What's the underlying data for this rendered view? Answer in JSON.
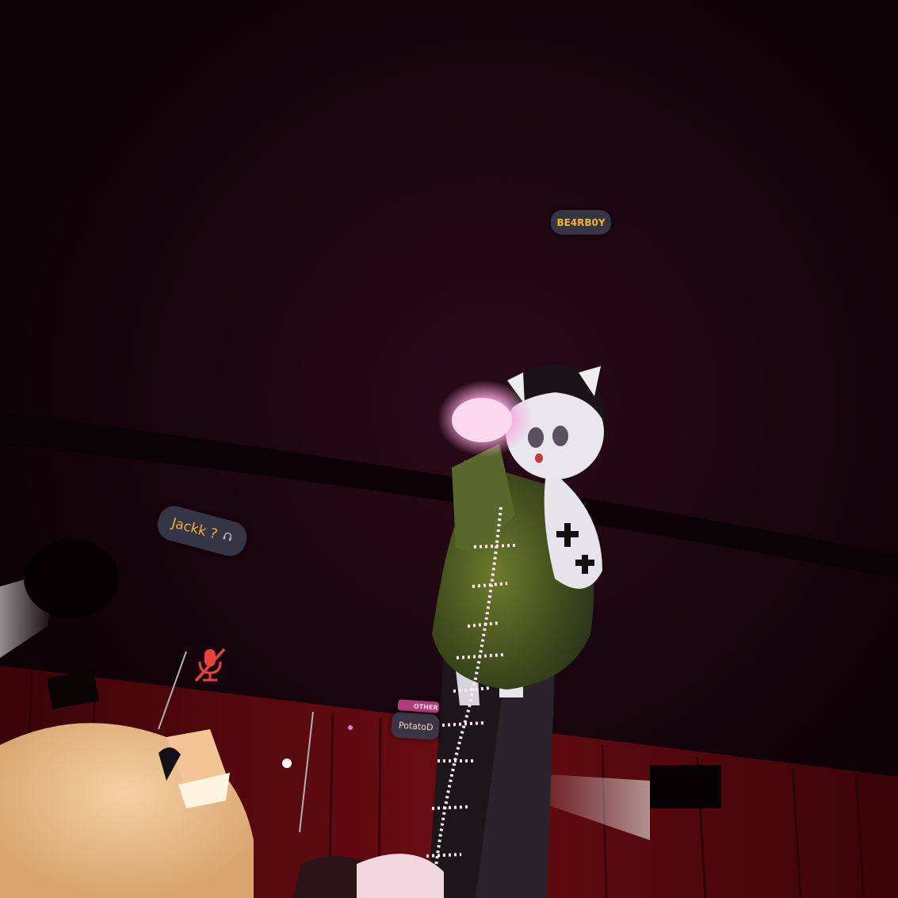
{
  "nameplates": {
    "bear": {
      "name": "BE4RB0Y"
    },
    "jack": {
      "name": "Jackk ?",
      "status_icon": "headphones-icon"
    },
    "potato": {
      "name": "PotatoD",
      "badge": "OTHER"
    }
  },
  "indicators": {
    "mute_icon": "microphone-muted-icon",
    "mute_color": "#e8423f"
  },
  "colors": {
    "nameplate_text": "#f2b233",
    "nameplate_bg": "#373a4b",
    "glow": "#f2a8d8",
    "stage_red": "#5a0a10"
  }
}
